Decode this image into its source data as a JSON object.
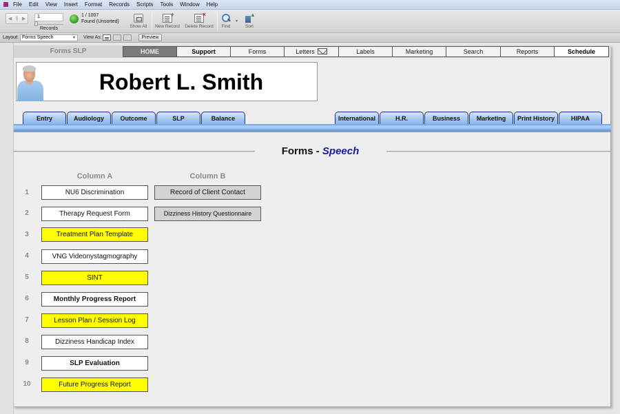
{
  "menubar": {
    "items": [
      "File",
      "Edit",
      "View",
      "Insert",
      "Format",
      "Records",
      "Scripts",
      "Tools",
      "Window",
      "Help"
    ]
  },
  "toolbar": {
    "record_number": "1",
    "records_label": "Records",
    "found_count": "1 / 1007",
    "found_state": "Found (Unsorted)",
    "show_all": "Show All",
    "new_record": "New Record",
    "delete_record": "Delete Record",
    "find": "Find",
    "sort": "Sort"
  },
  "layoutbar": {
    "layout_label": "Layout:",
    "layout_value": "Forms Speech",
    "view_as_label": "View As:",
    "preview": "Preview"
  },
  "topnav": {
    "brand": "Forms SLP",
    "tabs": [
      {
        "label": "HOME"
      },
      {
        "label": "Support"
      },
      {
        "label": "Forms"
      },
      {
        "label": "Letters"
      },
      {
        "label": "Labels"
      },
      {
        "label": "Marketing"
      },
      {
        "label": "Search"
      },
      {
        "label": "Reports"
      },
      {
        "label": "Schedule"
      }
    ]
  },
  "client": {
    "name": "Robert L. Smith"
  },
  "module_tabs": {
    "left": [
      "Entry",
      "Audiology",
      "Outcome",
      "SLP",
      "Balance"
    ],
    "right": [
      "International",
      "H.R.",
      "Business",
      "Marketing",
      "Print History",
      "HIPAA"
    ]
  },
  "section": {
    "title_prefix": "Forms - ",
    "title_accent": "Speech",
    "accent_color": "#1a1a9a"
  },
  "columns": {
    "a_header": "Column A",
    "b_header": "Column B"
  },
  "rows": [
    {
      "num": "1",
      "a": "NU6 Discrimination",
      "b": "Record of Client Contact"
    },
    {
      "num": "2",
      "a": "Therapy Request Form",
      "b": "Dizziness History Questionnaire"
    },
    {
      "num": "3",
      "a": "Treatment Plan Template"
    },
    {
      "num": "4",
      "a": "VNG Videonystagmography"
    },
    {
      "num": "5",
      "a": "SINT"
    },
    {
      "num": "6",
      "a": "Monthly Progress Report"
    },
    {
      "num": "7",
      "a": "Lesson Plan / Session Log"
    },
    {
      "num": "8",
      "a": "Dizziness Handicap Index"
    },
    {
      "num": "9",
      "a": "SLP Evaluation"
    },
    {
      "num": "10",
      "a": "Future Progress Report"
    }
  ],
  "colors": {
    "highlight_yellow": "#ffff00",
    "column_b_grey": "#d3d3d3",
    "module_tab_blue": "#a8c8f0"
  }
}
